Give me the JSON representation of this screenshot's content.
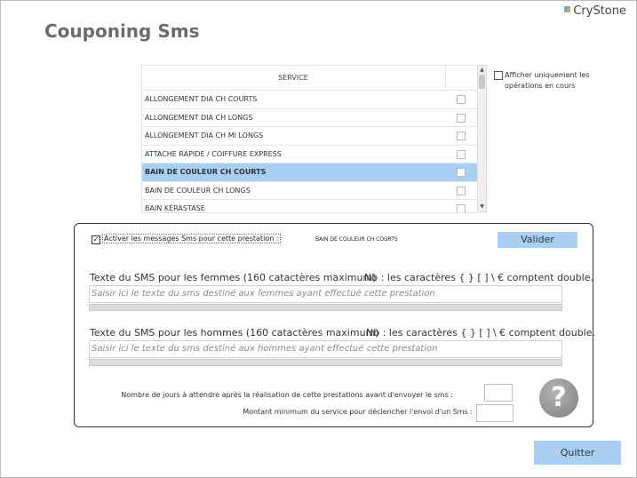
{
  "brand": "CryStone",
  "page_title": "Couponing Sms",
  "service_table": {
    "header": "SERVICE",
    "rows": [
      {
        "name": "ALLONGEMENT DIA CH COURTS",
        "selected": false
      },
      {
        "name": "ALLONGEMENT DIA CH LONGS",
        "selected": false
      },
      {
        "name": "ALLONGEMENT DIA CH MI LONGS",
        "selected": false
      },
      {
        "name": "ATTACHE RAPIDE / COIFFURE EXPRESS",
        "selected": false
      },
      {
        "name": "BAIN DE COULEUR CH COURTS",
        "selected": true
      },
      {
        "name": "BAIN DE COULEUR CH LONGS",
        "selected": false
      },
      {
        "name": "BAIN KÉRASTASE",
        "selected": false
      }
    ]
  },
  "filter_label": "Afficher uniquement les opérations en cours",
  "sms": {
    "activate_checked": true,
    "activate_label": "Activer les messages Sms pour cette prestation :",
    "current_service": "BAIN DE COULEUR CH COURTS",
    "validate_label": "Valider",
    "women_label": "Texte du SMS pour les femmes (160 catactères maximum)",
    "women_note": "Nb : les caractères { } [ ] \\ € comptent double.",
    "women_placeholder": "Saisir ici le texte du sms destiné aux femmes ayant effectué cette prestation",
    "men_label": "Texte du SMS pour les hommes (160 catactères maximum)",
    "men_note": "Nb : les caractères { } [ ] \\ € comptent double.",
    "men_placeholder": "Saisir ici le texte du sms destiné aux hommes ayant effectué cette prestation",
    "days_label": "Nombre de jours à attendre après la réalisation de cette prestations avant d'envoyer le sms :",
    "days_value": "",
    "amount_label": "Montant minimum du service pour déclencher l'envoi d'un Sms :",
    "amount_value": ""
  },
  "help_icon": "?",
  "quit_label": "Quitter"
}
